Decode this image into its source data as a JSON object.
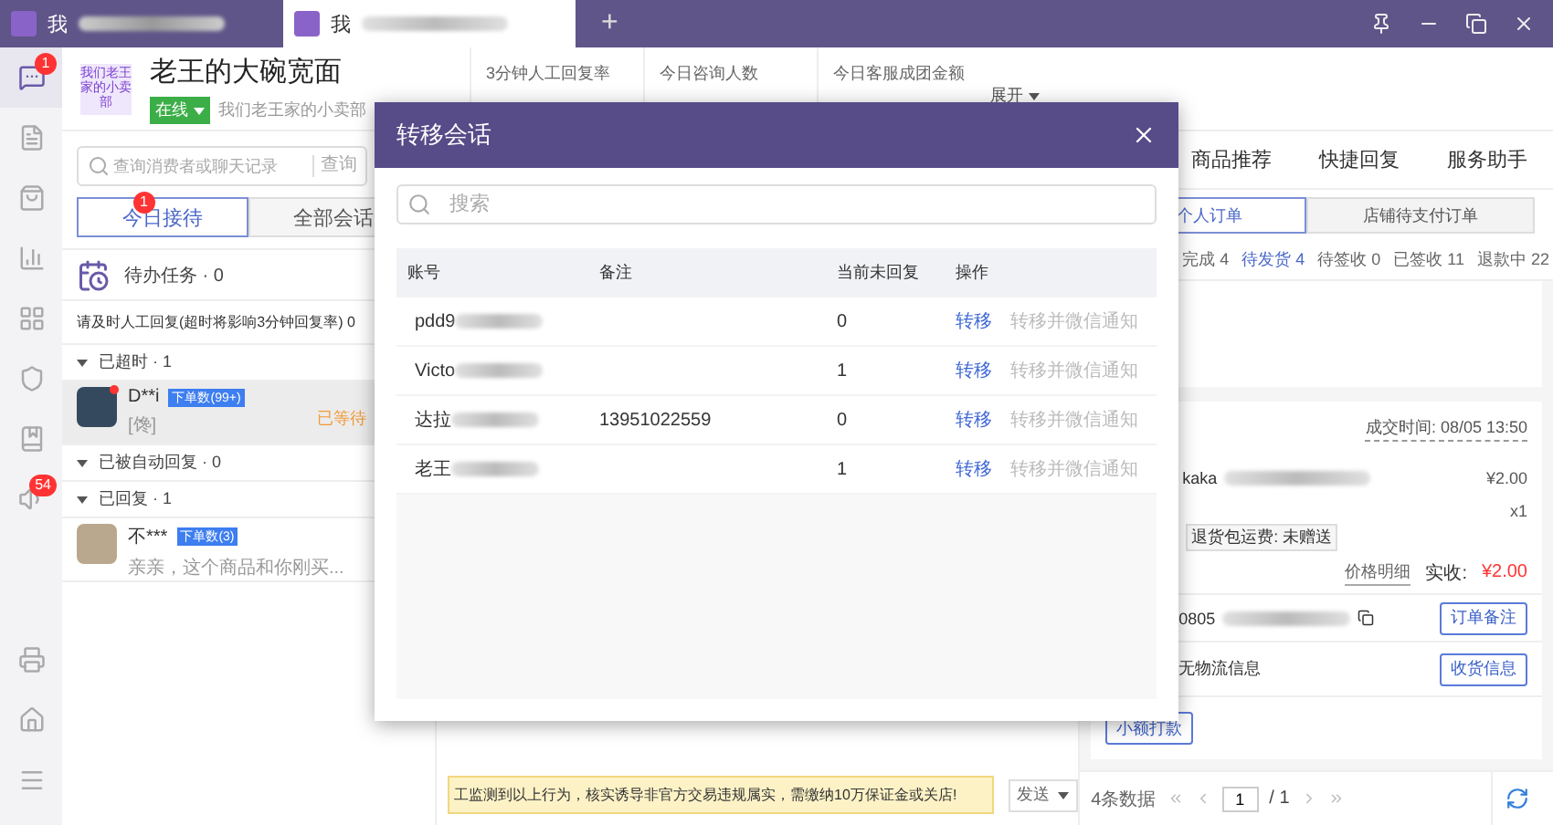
{
  "tabs": [
    {
      "label": "我",
      "selected": false
    },
    {
      "label": "我",
      "selected": true
    }
  ],
  "new_tab": "+",
  "rail": {
    "items": [
      {
        "selected": true,
        "badge": "1"
      },
      {
        "selected": false
      },
      {
        "selected": false
      },
      {
        "selected": false
      },
      {
        "selected": false
      },
      {
        "selected": false
      },
      {
        "selected": false
      },
      {
        "selected": false,
        "badge": "54"
      }
    ]
  },
  "shop": {
    "logo_text": "我们老王家的小卖部",
    "name": "老王的大碗宽面",
    "status": "在线",
    "slogan": "我们老王家的小卖部"
  },
  "stats": [
    {
      "label": "3分钟人工回复率"
    },
    {
      "label": "今日咨询人数"
    },
    {
      "label": "今日客服成团金额"
    }
  ],
  "expand": "展开",
  "search": {
    "placeholder": "查询消费者或聊天记录",
    "button": "查询"
  },
  "session_tabs": [
    {
      "label": "今日接待",
      "selected": true,
      "badge": "1"
    },
    {
      "label": "全部会话",
      "selected": false
    }
  ],
  "todo": "待办任务 · 0",
  "notice": "请及时人工回复(超时将影响3分钟回复率) 0",
  "groups": [
    {
      "label": "已超时 · 1",
      "expanded": true,
      "sessions": [
        {
          "name": "D**i",
          "tag": "下单数(99+)",
          "preview": "[馋]",
          "status": "已等待",
          "unread": true,
          "selected": true
        }
      ]
    },
    {
      "label": "已被自动回复 · 0",
      "expanded": true
    },
    {
      "label": "已回复 · 1",
      "expanded": true,
      "sessions": [
        {
          "name": "不***",
          "tag": "下单数(3)",
          "preview": "亲亲，这个商品和你刚买...",
          "unread": false,
          "selected": false
        }
      ]
    }
  ],
  "chat": {
    "warning": "工监测到以上行为，核实诱导非官方交易违规属实，需缴纳10万保证金或关店!",
    "send": "发送"
  },
  "right": {
    "tabs": [
      "商品推荐",
      "快捷回复",
      "服务助手"
    ],
    "order_tabs": [
      {
        "label": "个人订单",
        "selected": true
      },
      {
        "label": "店铺待支付订单",
        "selected": false
      }
    ],
    "filters": [
      {
        "label": "完成 4",
        "selected": false
      },
      {
        "label": "待发货 4",
        "selected": true
      },
      {
        "label": "待签收 0",
        "selected": false
      },
      {
        "label": "已签收 11",
        "selected": false
      },
      {
        "label": "退款中 22",
        "selected": false
      }
    ],
    "order": {
      "time": "成交时间: 08/05 13:50",
      "product": "kaka",
      "price": "¥2.00",
      "qty": "x1",
      "tag": "退货包运费: 未赠送",
      "detail": "价格明细",
      "paid_label": "实收:",
      "paid": "¥2.00",
      "order_no": "0805",
      "note_button": "订单备注",
      "logistics": "无物流信息",
      "address_button": "收货信息",
      "refund_button": "小额打款"
    },
    "pagination": {
      "count": "4条数据",
      "page": "1",
      "total": "/ 1"
    }
  },
  "modal": {
    "title": "转移会话",
    "search_placeholder": "搜索",
    "columns": [
      "账号",
      "备注",
      "当前未回复",
      "操作"
    ],
    "rows": [
      {
        "account": "pdd9",
        "unread": "0",
        "action": "转移",
        "action_notify": "转移并微信通知"
      },
      {
        "account": "Victo",
        "unread": "1",
        "action": "转移",
        "action_notify": "转移并微信通知"
      },
      {
        "account": "达拉",
        "note": "13951022559",
        "unread": "0",
        "action": "转移",
        "action_notify": "转移并微信通知"
      },
      {
        "account": "老王",
        "unread": "1",
        "action": "转移",
        "action_notify": "转移并微信通知"
      }
    ]
  }
}
